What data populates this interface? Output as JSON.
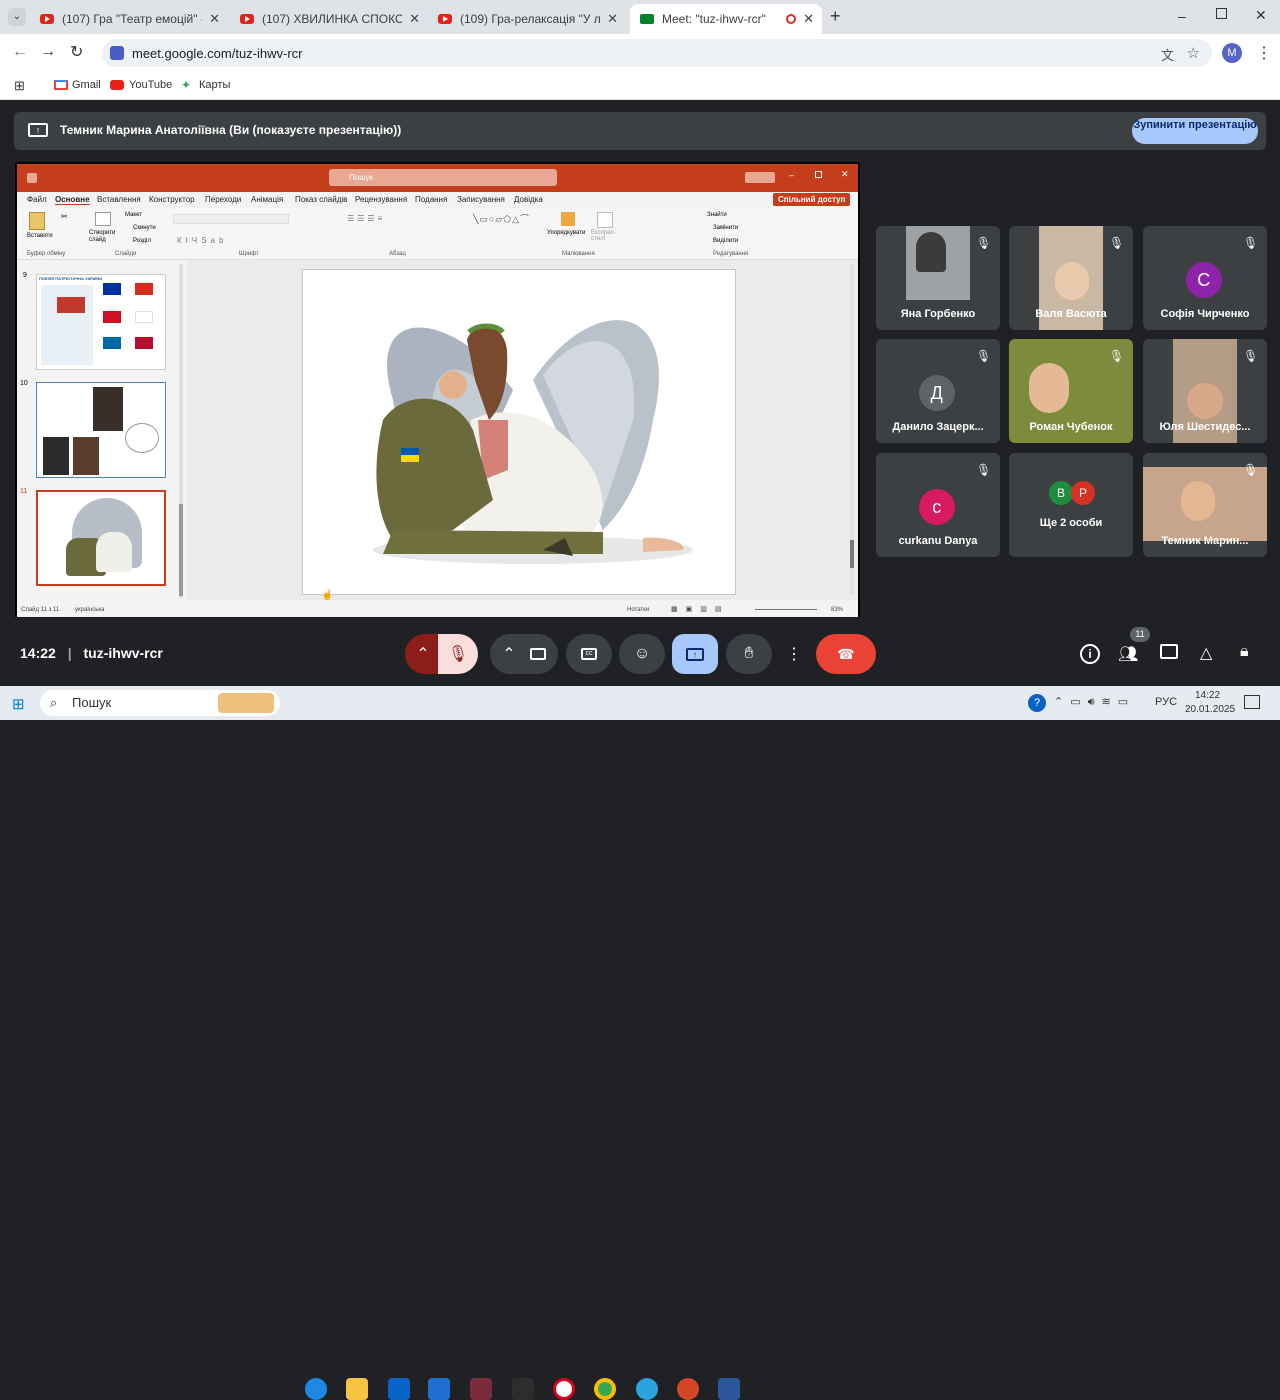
{
  "browser": {
    "tabs": [
      {
        "title": "(107) Гра \"Театр емоцій\" - You"
      },
      {
        "title": "(107) ХВИЛИНКА СПОКОЮ - Y"
      },
      {
        "title": "(109) Гра-релаксація \"У лісі\" - "
      },
      {
        "title": "Meet: \"tuz-ihwv-rcr\""
      }
    ],
    "new_tab": "+",
    "url": "meet.google.com/tuz-ihwv-rcr",
    "bookmarks": [
      "Gmail",
      "YouTube",
      "Карты"
    ],
    "profile_initial": "M"
  },
  "meet": {
    "presenting_banner": "Темник Марина Анатоліївна (Ви (показуєте презентацію))",
    "stop_button": "Зупинити презентацію",
    "meeting_time": "14:22",
    "meeting_code": "tuz-ihwv-rcr",
    "participant_count": "11",
    "participants": [
      {
        "name": "Яна Горбенко",
        "type": "video"
      },
      {
        "name": "Валя Васюта",
        "type": "video"
      },
      {
        "name": "Софія Чирченко",
        "type": "avatar",
        "initial": "С",
        "color": "#8e24aa"
      },
      {
        "name": "Данило Зацерк...",
        "type": "avatar",
        "initial": "Д",
        "color": "#5f6368"
      },
      {
        "name": "Роман Чубенок",
        "type": "video"
      },
      {
        "name": "Юля Шестидес...",
        "type": "video"
      },
      {
        "name": "curkanu Danya",
        "type": "avatar",
        "initial": "c",
        "color": "#d81b60"
      },
      {
        "name": "Ще 2 особи",
        "type": "group",
        "initials": [
          "B",
          "P"
        ]
      },
      {
        "name": "Темник Марин...",
        "type": "video"
      }
    ]
  },
  "ppt": {
    "search": "Пошук",
    "share_button": "Спільний доступ",
    "menu": [
      "Файл",
      "Основне",
      "Вставлення",
      "Конструктор",
      "Переходи",
      "Анімація",
      "Показ слайдів",
      "Рецензування",
      "Подання",
      "Записування",
      "Довідка"
    ],
    "ribbon_groups": [
      "Буфер обміну",
      "Слайди",
      "Шрифт",
      "Абзац",
      "Малювання",
      "Редагування"
    ],
    "ribbon_items": {
      "paste": "Вставити",
      "new_slide": "Створити слайд",
      "layout": "Макет",
      "reset": "Скинути",
      "section": "Розділ",
      "arrange": "Упорядкувати",
      "quick_styles": "Експрес-стилі",
      "find": "Знайти",
      "replace": "Замінити",
      "select": "Виділити"
    },
    "slide_numbers": [
      "9",
      "10",
      "11"
    ],
    "thumb9_title": "ПОЕЗІЯ ПАТРІОТИЧНА УКРАЇНИ",
    "status_slide": "Слайд 11 з 11",
    "status_lang": "українська",
    "notes": "Нотатки",
    "zoom": "83%"
  },
  "taskbar": {
    "search": "Пошук",
    "lang": "РУС",
    "time": "14:22",
    "date": "20.01.2025"
  },
  "colors": {
    "ppt_accent": "#c43e1c",
    "meet_bg": "#202124",
    "end_call": "#ea4335",
    "present_active": "#a8c7fa"
  }
}
